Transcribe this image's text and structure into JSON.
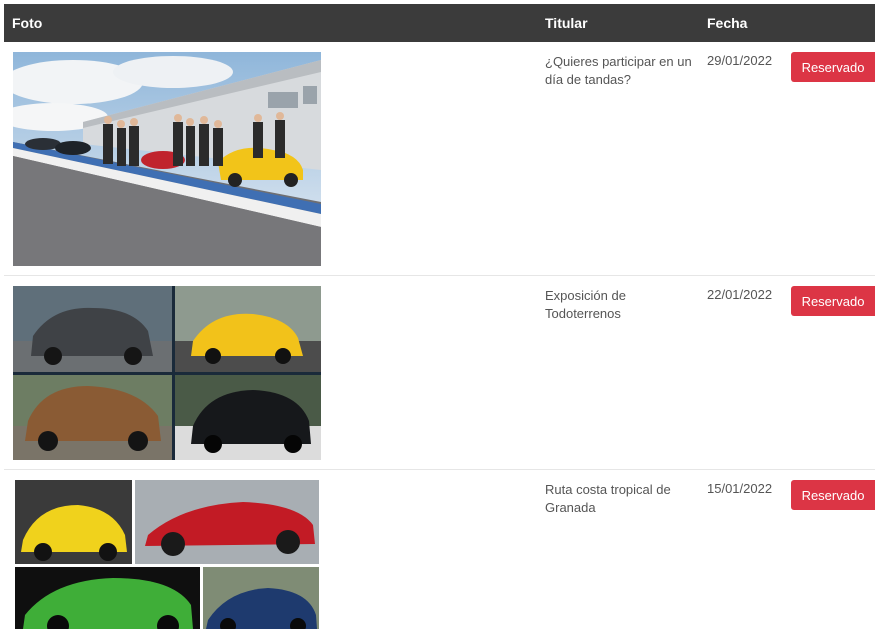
{
  "table": {
    "headers": {
      "foto": "Foto",
      "titular": "Titular",
      "fecha": "Fecha"
    },
    "rows": [
      {
        "image": "track-day-photo",
        "titular": "¿Quieres participar en un día de tandas?",
        "fecha": "29/01/2022",
        "action": "Reservado"
      },
      {
        "image": "suv-collage-photo",
        "titular": "Exposición de Todoterrenos",
        "fecha": "22/01/2022",
        "action": "Reservado"
      },
      {
        "image": "sports-car-collage-photo",
        "titular": "Ruta costa tropical de Granada",
        "fecha": "15/01/2022",
        "action": "Reservado"
      }
    ]
  },
  "colors": {
    "header_bg": "#3b3b3b",
    "button_bg": "#dc3545"
  }
}
